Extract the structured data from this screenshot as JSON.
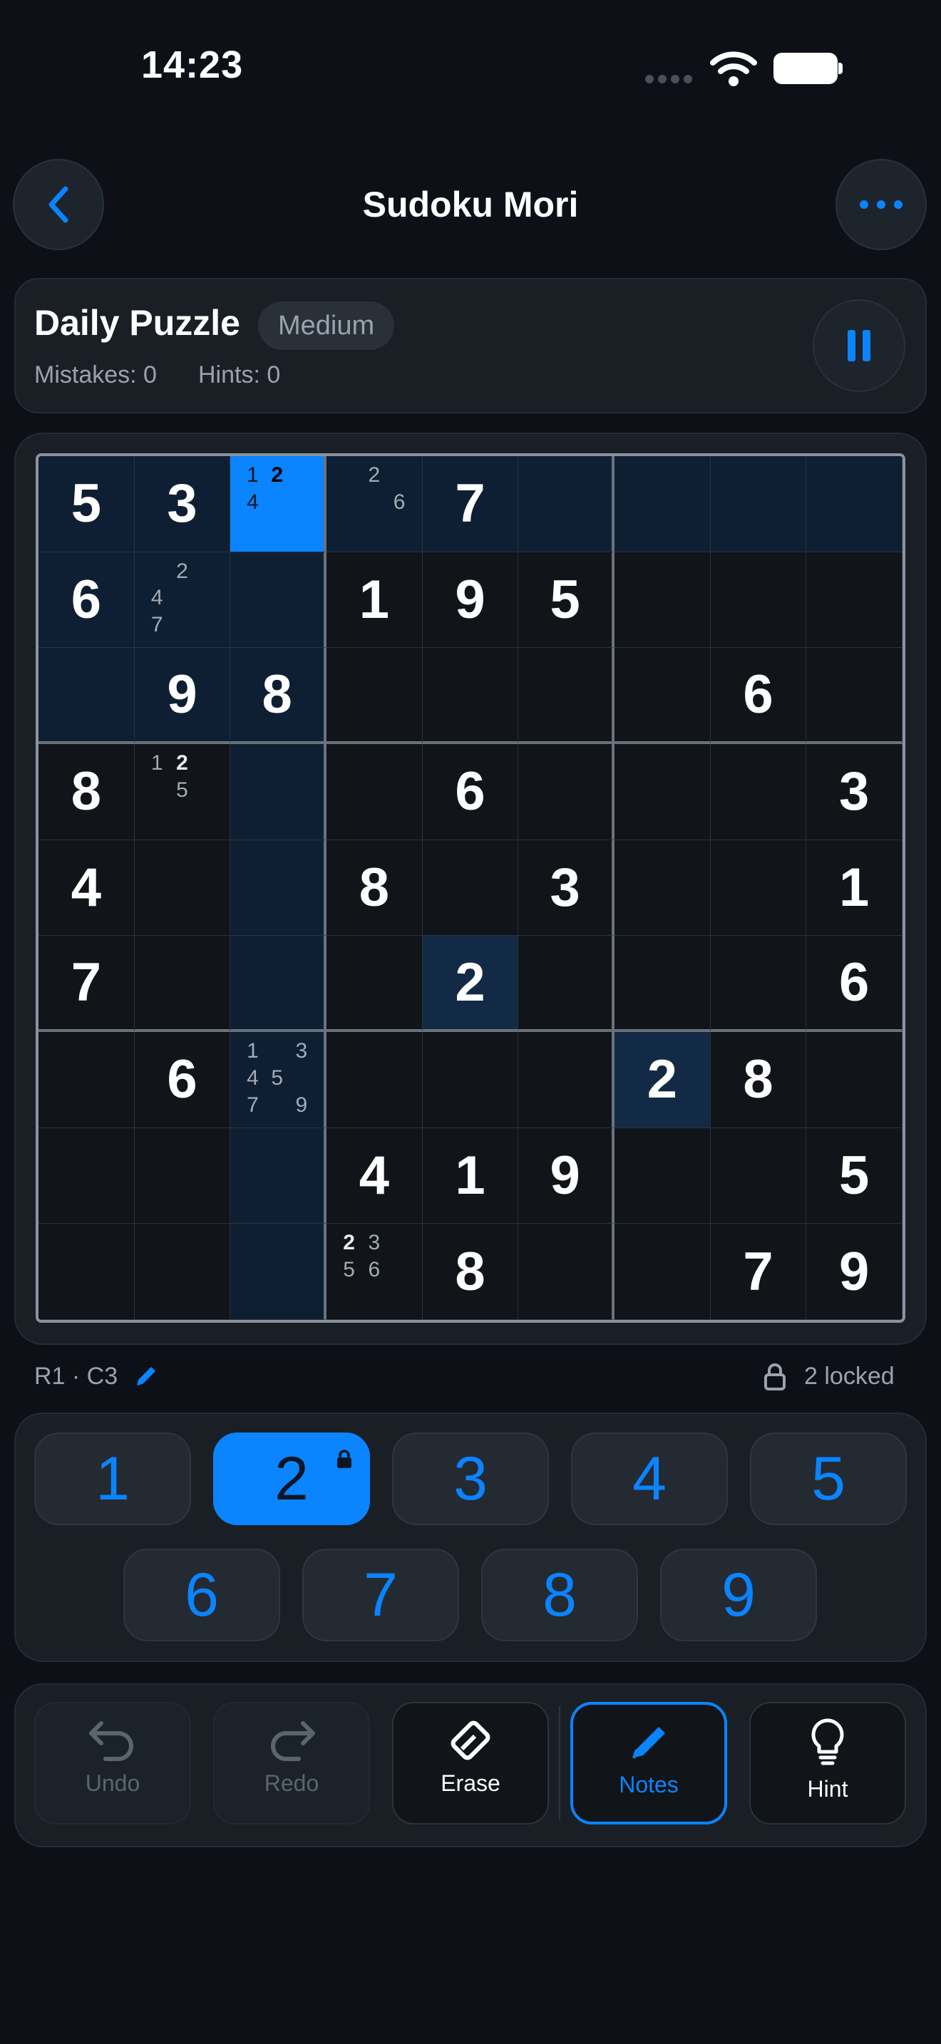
{
  "status_bar": {
    "time": "14:23"
  },
  "header": {
    "title": "Sudoku Mori",
    "back_icon": "chevron-left-icon",
    "more_icon": "ellipsis-icon"
  },
  "info": {
    "title": "Daily Puzzle",
    "difficulty": "Medium",
    "mistakes": "Mistakes: 0",
    "hints": "Hints: 0"
  },
  "board": {
    "selected": [
      0,
      2
    ],
    "highlight_digit": "2",
    "rows": [
      [
        {
          "v": "5"
        },
        {
          "v": "3"
        },
        {
          "n": [
            "1",
            "2",
            "",
            "4",
            "",
            "",
            "",
            "",
            ""
          ],
          "b": [
            "2"
          ]
        },
        {
          "n": [
            "",
            "2",
            "",
            "",
            "",
            "6",
            "",
            "",
            ""
          ],
          "b": []
        },
        {
          "v": "7"
        },
        {},
        {},
        {},
        {}
      ],
      [
        {
          "v": "6"
        },
        {
          "n": [
            "",
            "2",
            "",
            "4",
            "",
            "",
            "7",
            "",
            ""
          ],
          "b": []
        },
        {},
        {
          "v": "1"
        },
        {
          "v": "9"
        },
        {
          "v": "5"
        },
        {},
        {},
        {}
      ],
      [
        {},
        {
          "v": "9"
        },
        {
          "v": "8"
        },
        {},
        {},
        {},
        {},
        {
          "v": "6"
        },
        {}
      ],
      [
        {
          "v": "8"
        },
        {
          "n": [
            "1",
            "2",
            "",
            "",
            "5",
            "",
            "",
            "",
            ""
          ],
          "b": [
            "2"
          ]
        },
        {},
        {},
        {
          "v": "6"
        },
        {},
        {},
        {},
        {
          "v": "3"
        }
      ],
      [
        {
          "v": "4"
        },
        {},
        {},
        {
          "v": "8"
        },
        {},
        {
          "v": "3"
        },
        {},
        {},
        {
          "v": "1"
        }
      ],
      [
        {
          "v": "7"
        },
        {},
        {},
        {},
        {
          "v": "2"
        },
        {},
        {},
        {},
        {
          "v": "6"
        }
      ],
      [
        {},
        {
          "v": "6"
        },
        {
          "n": [
            "1",
            "",
            "3",
            "4",
            "5",
            "",
            "7",
            "",
            "9"
          ],
          "b": []
        },
        {},
        {},
        {},
        {
          "v": "2"
        },
        {
          "v": "8"
        },
        {}
      ],
      [
        {},
        {},
        {},
        {
          "v": "4"
        },
        {
          "v": "1"
        },
        {
          "v": "9"
        },
        {},
        {},
        {
          "v": "5"
        }
      ],
      [
        {},
        {},
        {},
        {
          "n": [
            "2",
            "3",
            "",
            "5",
            "6",
            "",
            "",
            "",
            ""
          ],
          "b": [
            "2"
          ]
        },
        {
          "v": "8"
        },
        {},
        {},
        {
          "v": "7"
        },
        {
          "v": "9"
        }
      ]
    ]
  },
  "status": {
    "cell": "R1 · C3",
    "locked": "2 locked"
  },
  "numpad": {
    "digits": [
      "1",
      "2",
      "3",
      "4",
      "5",
      "6",
      "7",
      "8",
      "9"
    ],
    "active": "2"
  },
  "actions": {
    "undo": "Undo",
    "redo": "Redo",
    "erase": "Erase",
    "notes": "Notes",
    "hint": "Hint"
  },
  "colors": {
    "accent": "#0a84ff",
    "background": "#0d1117",
    "card": "#1a1f26"
  }
}
